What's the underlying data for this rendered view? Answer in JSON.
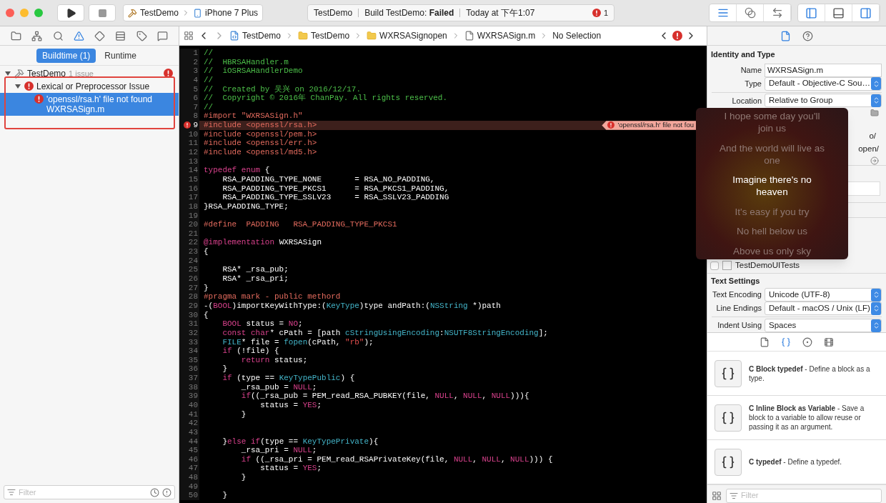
{
  "toolbar": {
    "scheme": {
      "project": "TestDemo",
      "device": "iPhone 7 Plus"
    },
    "activity": {
      "project": "TestDemo",
      "status": "Build TestDemo: **Failed**",
      "time": "Today at 下午1:07",
      "error_count": "1"
    },
    "editor_modes": [
      {
        "kind": "standard",
        "selected": true
      },
      {
        "kind": "assistant",
        "selected": false
      },
      {
        "kind": "version",
        "selected": false
      }
    ],
    "panels": [
      {
        "kind": "navigator",
        "on": true
      },
      {
        "kind": "debug",
        "on": false
      },
      {
        "kind": "utilities",
        "on": true
      }
    ]
  },
  "navigator": {
    "icons": [
      {
        "kind": "folder",
        "selected": false
      },
      {
        "kind": "hierarchy",
        "selected": false
      },
      {
        "kind": "search",
        "selected": false
      },
      {
        "kind": "issue",
        "selected": true
      },
      {
        "kind": "test",
        "selected": false
      },
      {
        "kind": "debug",
        "selected": false
      },
      {
        "kind": "breakpoint",
        "selected": false
      },
      {
        "kind": "report",
        "selected": false
      }
    ],
    "tabs": [
      {
        "label": "Buildtime (1)",
        "selected": true
      },
      {
        "label": "Runtime",
        "selected": false
      }
    ],
    "tree": [
      {
        "label": "TestDemo",
        "detail": "1 issue",
        "kind": "project",
        "expanded": true,
        "children": [
          {
            "label": "Lexical or Preprocessor Issue",
            "kind": "group",
            "expanded": true,
            "children": [
              {
                "label": "'openssl/rsa.h' file not found",
                "detail": "WXRSASign.m",
                "kind": "error",
                "selected": true
              }
            ]
          }
        ]
      }
    ],
    "filter": {
      "placeholder": "Filter"
    }
  },
  "editor": {
    "breadcrumbs": [
      {
        "kind": "project",
        "label": "TestDemo"
      },
      {
        "kind": "folder",
        "label": "TestDemo"
      },
      {
        "kind": "folder",
        "label": "WXRSASignopen"
      },
      {
        "kind": "file",
        "label": "WXRSASign.m"
      },
      {
        "kind": "plain",
        "label": "No Selection"
      }
    ],
    "lines": [
      {
        "n": "1",
        "segs": [
          {
            "text": "//",
            "kind": "comment"
          }
        ]
      },
      {
        "n": "2",
        "segs": [
          {
            "text": "//  HBRSAHandler.m",
            "kind": "comment"
          }
        ]
      },
      {
        "n": "3",
        "segs": [
          {
            "text": "//  iOSRSAHandlerDemo",
            "kind": "comment"
          }
        ]
      },
      {
        "n": "4",
        "segs": [
          {
            "text": "//",
            "kind": "comment"
          }
        ]
      },
      {
        "n": "5",
        "segs": [
          {
            "text": "//  Created by 吴兴 on 2016/12/17.",
            "kind": "comment"
          }
        ]
      },
      {
        "n": "6",
        "segs": [
          {
            "text": "//  Copyright © 2016年 ChanPay. All rights reserved.",
            "kind": "comment"
          }
        ]
      },
      {
        "n": "7",
        "segs": [
          {
            "text": "//",
            "kind": "comment"
          }
        ]
      },
      {
        "n": "8",
        "segs": [
          {
            "text": "#import \"WXRSASign.h\"",
            "kind": "preprocessor"
          }
        ]
      },
      {
        "n": "9",
        "error": "'openssl/rsa.h' file not fou",
        "segs": [
          {
            "text": "#include <openssl/rsa.h>",
            "kind": "preprocessor"
          }
        ]
      },
      {
        "n": "10",
        "segs": [
          {
            "text": "#include <openssl/pem.h>",
            "kind": "preprocessor"
          }
        ]
      },
      {
        "n": "11",
        "segs": [
          {
            "text": "#include <openssl/err.h>",
            "kind": "preprocessor"
          }
        ]
      },
      {
        "n": "12",
        "segs": [
          {
            "text": "#include <openssl/md5.h>",
            "kind": "preprocessor"
          }
        ]
      },
      {
        "n": "13"
      },
      {
        "n": "14",
        "segs": [
          {
            "text": "typedef enum",
            "kind": "keyword"
          },
          {
            "text": " {",
            "kind": "plain"
          }
        ]
      },
      {
        "n": "15",
        "segs": [
          {
            "text": "    RSA_PADDING_TYPE_NONE       = RSA_NO_PADDING,",
            "kind": "plain"
          }
        ]
      },
      {
        "n": "16",
        "segs": [
          {
            "text": "    RSA_PADDING_TYPE_PKCS1      = RSA_PKCS1_PADDING,",
            "kind": "plain"
          }
        ]
      },
      {
        "n": "17",
        "segs": [
          {
            "text": "    RSA_PADDING_TYPE_SSLV23     = RSA_SSLV23_PADDING",
            "kind": "plain"
          }
        ]
      },
      {
        "n": "18",
        "segs": [
          {
            "text": "}RSA_PADDING_TYPE;",
            "kind": "plain"
          }
        ]
      },
      {
        "n": "19"
      },
      {
        "n": "20",
        "segs": [
          {
            "text": "#define  PADDING   RSA_PADDING_TYPE_PKCS1",
            "kind": "preprocessor"
          }
        ]
      },
      {
        "n": "21"
      },
      {
        "n": "22",
        "segs": [
          {
            "text": "@implementation",
            "kind": "keyword"
          },
          {
            "text": " WXRSASign",
            "kind": "plain"
          }
        ]
      },
      {
        "n": "23",
        "segs": [
          {
            "text": "{",
            "kind": "plain"
          }
        ]
      },
      {
        "n": "24"
      },
      {
        "n": "25",
        "segs": [
          {
            "text": "    RSA* _rsa_pub;",
            "kind": "plain"
          }
        ]
      },
      {
        "n": "26",
        "segs": [
          {
            "text": "    RSA* _rsa_pri;",
            "kind": "plain"
          }
        ]
      },
      {
        "n": "27",
        "segs": [
          {
            "text": "}",
            "kind": "plain"
          }
        ]
      },
      {
        "n": "28",
        "segs": [
          {
            "text": "#pragma mark - public methord",
            "kind": "preprocessor"
          }
        ]
      },
      {
        "n": "29",
        "segs": [
          {
            "text": "-(",
            "kind": "plain"
          },
          {
            "text": "BOOL",
            "kind": "keyword"
          },
          {
            "text": ")importKeyWithType:(",
            "kind": "plain"
          },
          {
            "text": "KeyType",
            "kind": "type"
          },
          {
            "text": ")type andPath:(",
            "kind": "plain"
          },
          {
            "text": "NSString",
            "kind": "type"
          },
          {
            "text": " *)path",
            "kind": "plain"
          }
        ]
      },
      {
        "n": "30",
        "segs": [
          {
            "text": "{",
            "kind": "plain"
          }
        ]
      },
      {
        "n": "31",
        "segs": [
          {
            "text": "    BOOL",
            "kind": "keyword"
          },
          {
            "text": " status = ",
            "kind": "plain"
          },
          {
            "text": "NO",
            "kind": "keyword"
          },
          {
            "text": ";",
            "kind": "plain"
          }
        ]
      },
      {
        "n": "32",
        "segs": [
          {
            "text": "    const char",
            "kind": "keyword"
          },
          {
            "text": "* cPath = [path ",
            "kind": "plain"
          },
          {
            "text": "cStringUsingEncoding",
            "kind": "type"
          },
          {
            "text": ":",
            "kind": "plain"
          },
          {
            "text": "NSUTF8StringEncoding",
            "kind": "type"
          },
          {
            "text": "];",
            "kind": "plain"
          }
        ]
      },
      {
        "n": "33",
        "segs": [
          {
            "text": "    FILE",
            "kind": "type"
          },
          {
            "text": "* file = ",
            "kind": "plain"
          },
          {
            "text": "fopen",
            "kind": "type"
          },
          {
            "text": "(cPath, ",
            "kind": "plain"
          },
          {
            "text": "\"rb\"",
            "kind": "string"
          },
          {
            "text": ");",
            "kind": "plain"
          }
        ]
      },
      {
        "n": "34",
        "segs": [
          {
            "text": "    if",
            "kind": "keyword"
          },
          {
            "text": " (!file) {",
            "kind": "plain"
          }
        ]
      },
      {
        "n": "35",
        "segs": [
          {
            "text": "        return",
            "kind": "keyword"
          },
          {
            "text": " status;",
            "kind": "plain"
          }
        ]
      },
      {
        "n": "36",
        "segs": [
          {
            "text": "    }",
            "kind": "plain"
          }
        ]
      },
      {
        "n": "37",
        "segs": [
          {
            "text": "    if",
            "kind": "keyword"
          },
          {
            "text": " (type == ",
            "kind": "plain"
          },
          {
            "text": "KeyTypePublic",
            "kind": "type"
          },
          {
            "text": ") {",
            "kind": "plain"
          }
        ]
      },
      {
        "n": "38",
        "segs": [
          {
            "text": "        _rsa_pub = ",
            "kind": "plain"
          },
          {
            "text": "NULL",
            "kind": "keyword"
          },
          {
            "text": ";",
            "kind": "plain"
          }
        ]
      },
      {
        "n": "39",
        "segs": [
          {
            "text": "        if",
            "kind": "keyword"
          },
          {
            "text": "((_rsa_pub = PEM_read_RSA_PUBKEY(file, ",
            "kind": "plain"
          },
          {
            "text": "NULL",
            "kind": "keyword"
          },
          {
            "text": ", ",
            "kind": "plain"
          },
          {
            "text": "NULL",
            "kind": "keyword"
          },
          {
            "text": ", ",
            "kind": "plain"
          },
          {
            "text": "NULL",
            "kind": "keyword"
          },
          {
            "text": "))){",
            "kind": "plain"
          }
        ]
      },
      {
        "n": "40",
        "segs": [
          {
            "text": "            status = ",
            "kind": "plain"
          },
          {
            "text": "YES",
            "kind": "keyword"
          },
          {
            "text": ";",
            "kind": "plain"
          }
        ]
      },
      {
        "n": "41",
        "segs": [
          {
            "text": "        }",
            "kind": "plain"
          }
        ]
      },
      {
        "n": "42"
      },
      {
        "n": "43"
      },
      {
        "n": "44",
        "segs": [
          {
            "text": "    }",
            "kind": "plain"
          },
          {
            "text": "else if",
            "kind": "keyword"
          },
          {
            "text": "(type == ",
            "kind": "plain"
          },
          {
            "text": "KeyTypePrivate",
            "kind": "type"
          },
          {
            "text": "){",
            "kind": "plain"
          }
        ]
      },
      {
        "n": "45",
        "segs": [
          {
            "text": "        _rsa_pri = ",
            "kind": "plain"
          },
          {
            "text": "NULL",
            "kind": "keyword"
          },
          {
            "text": ";",
            "kind": "plain"
          }
        ]
      },
      {
        "n": "46",
        "segs": [
          {
            "text": "        if",
            "kind": "keyword"
          },
          {
            "text": " ((_rsa_pri = PEM_read_RSAPrivateKey(file, ",
            "kind": "plain"
          },
          {
            "text": "NULL",
            "kind": "keyword"
          },
          {
            "text": ", ",
            "kind": "plain"
          },
          {
            "text": "NULL",
            "kind": "keyword"
          },
          {
            "text": ", ",
            "kind": "plain"
          },
          {
            "text": "NULL",
            "kind": "keyword"
          },
          {
            "text": "))) {",
            "kind": "plain"
          }
        ]
      },
      {
        "n": "47",
        "segs": [
          {
            "text": "            status = ",
            "kind": "plain"
          },
          {
            "text": "YES",
            "kind": "keyword"
          },
          {
            "text": ";",
            "kind": "plain"
          }
        ]
      },
      {
        "n": "48",
        "segs": [
          {
            "text": "        }",
            "kind": "plain"
          }
        ]
      },
      {
        "n": "49"
      },
      {
        "n": "50",
        "segs": [
          {
            "text": "    }",
            "kind": "plain"
          }
        ]
      }
    ]
  },
  "inspector": {
    "tabs": [
      {
        "kind": "file",
        "selected": true
      },
      {
        "kind": "help",
        "selected": false
      }
    ],
    "identity": {
      "title": "Identity and Type",
      "fields": [
        {
          "label": "Name",
          "kind": "text",
          "value": "WXRSASign.m"
        },
        {
          "label": "Type",
          "kind": "select",
          "value": "Default - Objective-C Sou…"
        },
        {
          "label": "Location",
          "kind": "select",
          "value": "Relative to Group"
        }
      ],
      "path_fragments": [
        "o/",
        "open/"
      ]
    },
    "targets": [
      {
        "label": "TestDemoUITests",
        "checked": false
      }
    ],
    "text_settings": {
      "title": "Text Settings",
      "fields": [
        {
          "label": "Text Encoding",
          "value": "Unicode (UTF-8)"
        },
        {
          "label": "Line Endings",
          "value": "Default - macOS / Unix (LF)"
        },
        {
          "label": "Indent Using",
          "value": "Spaces"
        }
      ]
    }
  },
  "library": {
    "tabs": [
      {
        "kind": "file",
        "selected": false
      },
      {
        "kind": "snippet",
        "selected": true
      },
      {
        "kind": "object",
        "selected": false
      },
      {
        "kind": "media",
        "selected": false
      }
    ],
    "items": [
      {
        "text": "**C Block typedef** - Define a block as a type."
      },
      {
        "text": "**C Inline Block as Variable** - Save a block to a variable to allow reuse or passing it as an argument."
      },
      {
        "text": "**C typedef** - Define a typedef."
      }
    ],
    "filter": {
      "placeholder": "Filter"
    }
  },
  "lyrics": [
    {
      "text": "I hope some day you'll join us",
      "current": false
    },
    {
      "text": "And the world will live as one",
      "current": false
    },
    {
      "text": "Imagine there's no heaven",
      "current": true
    },
    {
      "text": "It's easy if you try",
      "current": false
    },
    {
      "text": "No hell below us",
      "current": false
    },
    {
      "text": "Above us only sky",
      "current": false
    }
  ]
}
